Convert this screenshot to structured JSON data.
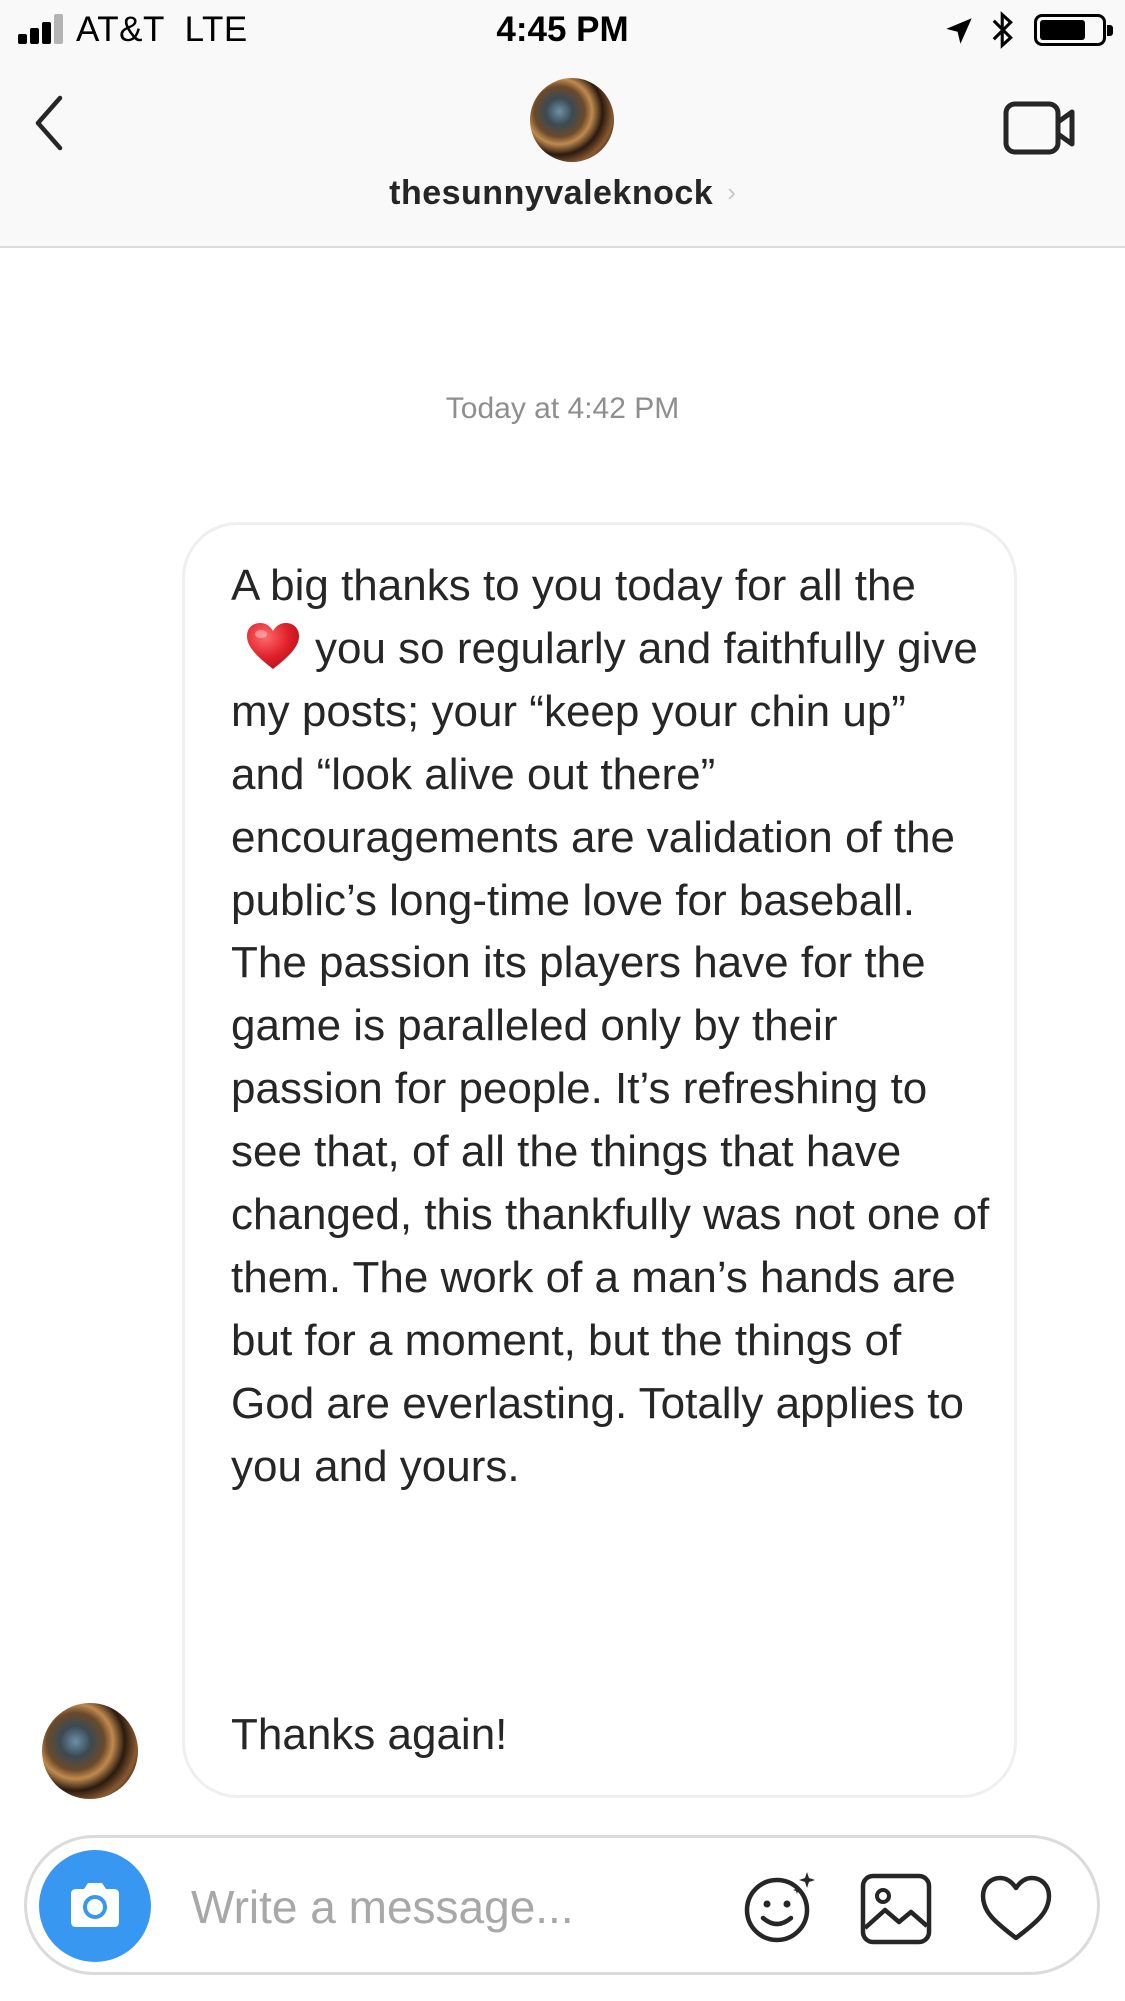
{
  "status_bar": {
    "carrier": "AT&T  LTE",
    "time": "4:45 PM",
    "signal_bars_filled": 3,
    "battery_level": 0.75
  },
  "header": {
    "username": "thesunnyvaleknock",
    "icons": [
      "back-icon",
      "video-call-icon",
      "chevron-right-icon"
    ]
  },
  "conversation": {
    "timestamp": "Today at 4:42 PM",
    "message": {
      "part1": "A big thanks to you today for all the",
      "emoji": "❤️",
      "part2": "you so regularly and faithfully give my posts; your “keep your chin up” and “look alive out there” encouragements are validation of the public’s long-time love for baseball. The passion its players have for the game is paralleled only by their passion for people. It’s refreshing to see that, of all the things that have changed, this thankfully was not one of them. The work of a man’s hands are but for a moment, but the things of God are everlasting. Totally applies to you and yours.",
      "closing": "Thanks again!"
    }
  },
  "composer": {
    "placeholder": "Write a message...",
    "value": "",
    "icons": [
      "camera-icon",
      "sticker-icon",
      "gallery-icon",
      "heart-icon"
    ],
    "accent_color": "#3897f0"
  }
}
